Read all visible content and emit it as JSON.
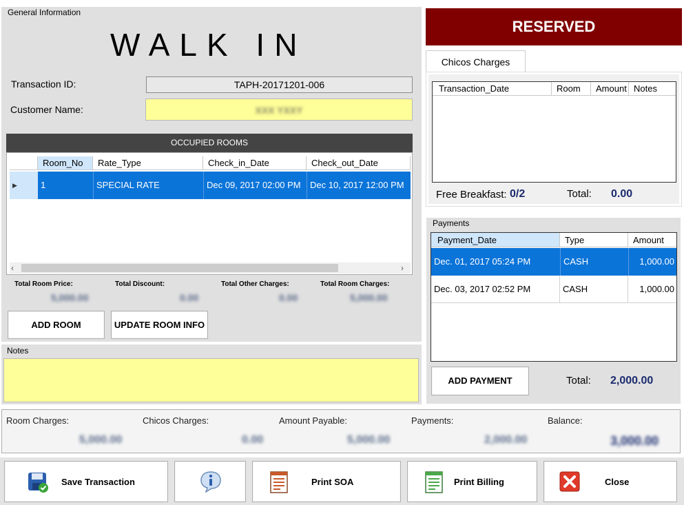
{
  "general": {
    "title": "General Information",
    "walk_in": "WALK IN",
    "transaction_label": "Transaction ID:",
    "transaction_id": "TAPH-20171201-006",
    "customer_label": "Customer Name:",
    "customer_name": "XXX YXXY"
  },
  "rooms": {
    "header": "OCCUPIED ROOMS",
    "columns": [
      "Room_No",
      "Rate_Type",
      "Check_in_Date",
      "Check_out_Date"
    ],
    "rows": [
      {
        "room_no": "1",
        "rate_type": "SPECIAL RATE",
        "check_in": "Dec 09, 2017 02:00 PM",
        "check_out": "Dec 10, 2017 12:00 PM"
      }
    ],
    "totals": {
      "room_price_label": "Total Room Price:",
      "room_price": "5,000.00",
      "discount_label": "Total Discount:",
      "discount": "0.00",
      "other_label": "Total Other Charges:",
      "other": "0.00",
      "room_charges_label": "Total Room Charges:",
      "room_charges": "5,000.00"
    },
    "add_room": "ADD ROOM",
    "update_room": "UPDATE ROOM INFO"
  },
  "notes": {
    "title": "Notes",
    "value": ""
  },
  "status": {
    "label": "RESERVED",
    "color": "#800000"
  },
  "chicos": {
    "tab": "Chicos Charges",
    "columns": [
      "Transaction_Date",
      "Room",
      "Amount",
      "Notes"
    ],
    "free_breakfast_label": "Free Breakfast:",
    "free_breakfast": "0/2",
    "total_label": "Total:",
    "total": "0.00"
  },
  "payments": {
    "title": "Payments",
    "columns": [
      "Payment_Date",
      "Type",
      "Amount"
    ],
    "rows": [
      {
        "date": "Dec. 01, 2017 05:24 PM",
        "type": "CASH",
        "amount": "1,000.00"
      },
      {
        "date": "Dec. 03, 2017 02:52 PM",
        "type": "CASH",
        "amount": "1,000.00"
      }
    ],
    "add_payment": "ADD PAYMENT",
    "total_label": "Total:",
    "total": "2,000.00"
  },
  "summary": {
    "room_charges_label": "Room Charges:",
    "room_charges": "5,000.00",
    "chicos_label": "Chicos Charges:",
    "chicos": "0.00",
    "payable_label": "Amount Payable:",
    "payable": "5,000.00",
    "payments_label": "Payments:",
    "payments": "2,000.00",
    "balance_label": "Balance:",
    "balance": "3,000.00"
  },
  "buttons": {
    "save": "Save Transaction",
    "print_soa": "Print SOA",
    "print_billing": "Print Billing",
    "close": "Close"
  },
  "icons": [
    "save-icon",
    "info-icon",
    "soa-document-icon",
    "billing-document-icon",
    "close-icon"
  ]
}
